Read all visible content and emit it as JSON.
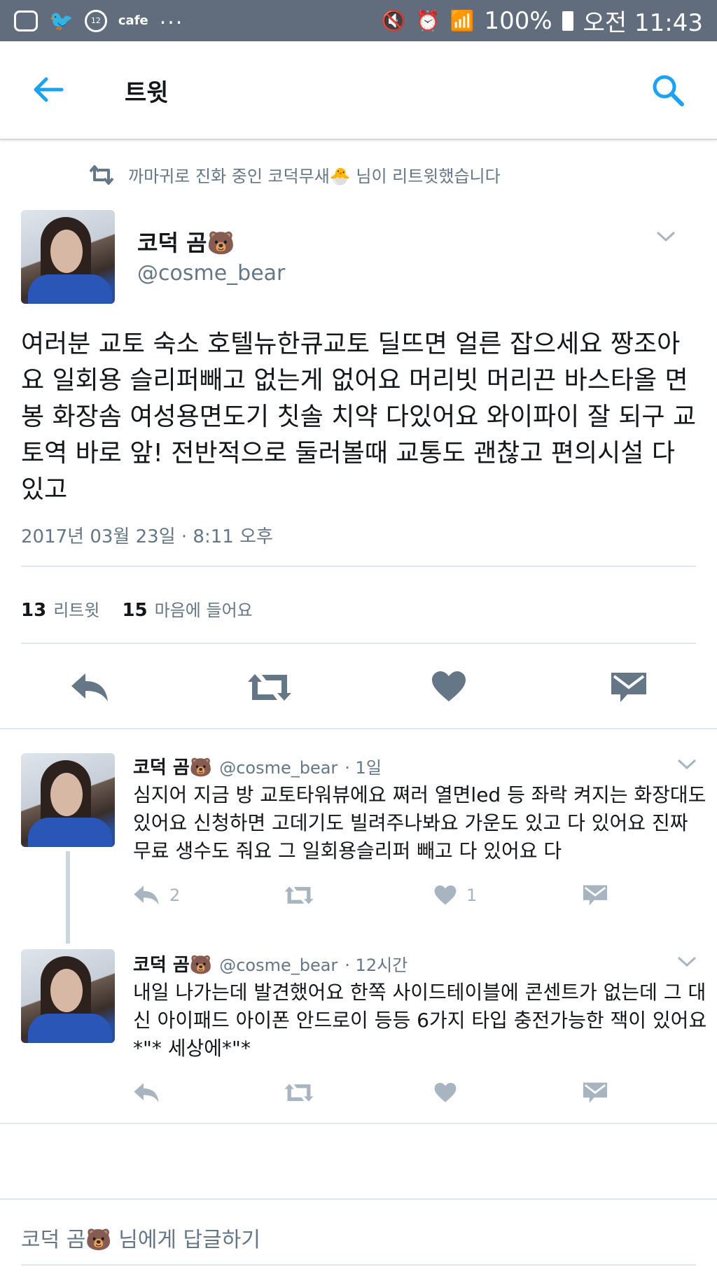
{
  "status_bar": {
    "left_text": "cafe",
    "left_badge": "12",
    "dots": "...",
    "battery": "100%",
    "time": "오전 11:43"
  },
  "header": {
    "title": "트윗"
  },
  "retweet_banner": {
    "text": "까마귀로 진화 중인 코덕무새🐣 님이 리트윗했습니다"
  },
  "main_tweet": {
    "name": "코덕 곰🐻",
    "handle": "@cosme_bear",
    "text": "여러분 교토 숙소 호텔뉴한큐교토 딜뜨면 얼른 잡으세요 짱조아요 일회용 슬리퍼빼고 없는게 없어요 머리빗 머리끈 바스타올 면봉 화장솜 여성용면도기 칫솔 치약 다있어요 와이파이 잘 되구 교토역 바로 앞! 전반적으로 둘러볼때 교통도 괜찮고 편의시설 다 있고",
    "timestamp": "2017년 03월 23일 · 8:11 오후",
    "retweets_count": "13",
    "retweets_label": "리트윗",
    "likes_count": "15",
    "likes_label": "마음에 들어요"
  },
  "replies": [
    {
      "name": "코덕 곰🐻",
      "handle": "@cosme_bear",
      "time": "· 1일",
      "text": "심지어 지금 방 교토타워뷰에요 쪄러 열면led 등 좌락 켜지는 화장대도 있어요 신청하면 고데기도 빌려주나봐요 가운도 있고 다 있어요 진짜 무료 생수도 줘요 그 일회용슬리퍼 빼고 다 있어요 다",
      "reply_count": "2",
      "like_count": "1"
    },
    {
      "name": "코덕 곰🐻",
      "handle": "@cosme_bear",
      "time": "· 12시간",
      "text": "내일 나가는데 발견했어요 한쪽 사이드테이블에 콘센트가 없는데 그 대신 아이패드 아이폰 안드로이 등등 6가지 타입 충전가능한 잭이 있어요*\"* 세상에*\"*",
      "reply_count": "",
      "like_count": ""
    }
  ],
  "reply_prompt": "코덕 곰🐻 님에게 답글하기",
  "colors": {
    "accent": "#1da1f2",
    "status_bar": "#616d7d",
    "icon_main": "#657786",
    "icon_small": "#a8b4bf"
  }
}
